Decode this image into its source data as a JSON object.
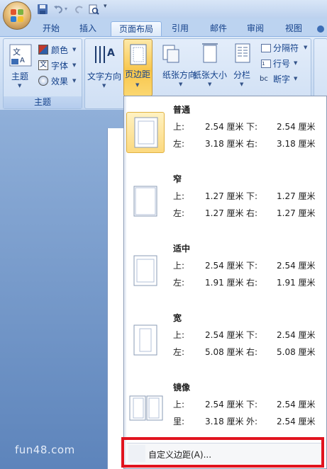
{
  "tabs": [
    "开始",
    "插入",
    "页面布局",
    "引用",
    "邮件",
    "审阅",
    "视图"
  ],
  "active_tab_index": 2,
  "ribbon": {
    "themes": {
      "theme_label": "主题",
      "colors_label": "颜色",
      "fonts_label": "字体",
      "effects_label": "效果",
      "group_label": "主题"
    },
    "page_setup": {
      "text_direction": "文字方向",
      "margins": "页边距",
      "orientation": "纸张方向",
      "size": "纸张大小",
      "columns": "分栏",
      "breaks": "分隔符",
      "line_numbers": "行号",
      "hyphenation": "断字"
    }
  },
  "margins_menu": {
    "items": [
      {
        "name": "普通",
        "row1": {
          "l1": "上:",
          "v1": "2.54 厘米",
          "l2": "下:",
          "v2": "2.54 厘米"
        },
        "row2": {
          "l1": "左:",
          "v1": "3.18 厘米",
          "l2": "右:",
          "v2": "3.18 厘米"
        },
        "selected": true
      },
      {
        "name": "窄",
        "row1": {
          "l1": "上:",
          "v1": "1.27 厘米",
          "l2": "下:",
          "v2": "1.27 厘米"
        },
        "row2": {
          "l1": "左:",
          "v1": "1.27 厘米",
          "l2": "右:",
          "v2": "1.27 厘米"
        }
      },
      {
        "name": "适中",
        "row1": {
          "l1": "上:",
          "v1": "2.54 厘米",
          "l2": "下:",
          "v2": "2.54 厘米"
        },
        "row2": {
          "l1": "左:",
          "v1": "1.91 厘米",
          "l2": "右:",
          "v2": "1.91 厘米"
        }
      },
      {
        "name": "宽",
        "row1": {
          "l1": "上:",
          "v1": "2.54 厘米",
          "l2": "下:",
          "v2": "2.54 厘米"
        },
        "row2": {
          "l1": "左:",
          "v1": "5.08 厘米",
          "l2": "右:",
          "v2": "5.08 厘米"
        }
      },
      {
        "name": "镜像",
        "row1": {
          "l1": "上:",
          "v1": "2.54 厘米",
          "l2": "下:",
          "v2": "2.54 厘米"
        },
        "row2": {
          "l1": "里:",
          "v1": "3.18 厘米",
          "l2": "外:",
          "v2": "2.54 厘米"
        }
      }
    ],
    "custom_label": "自定义边距(A)..."
  },
  "watermark": "fun48.com",
  "colors": {
    "highlight": "#fcd97f",
    "annotation_box": "#e1141f"
  }
}
